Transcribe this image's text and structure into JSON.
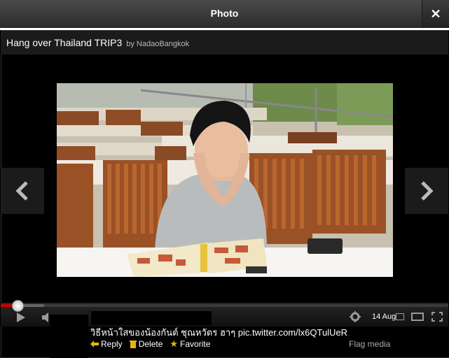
{
  "window": {
    "title": "Photo"
  },
  "media": {
    "title": "Hang over Thailand TRIP3",
    "byline": "by NadaoBangkok"
  },
  "player": {
    "date": "14 Aug"
  },
  "tweet": {
    "text": "วิธีหน้าใสของน้องกันต์ ชุณหวัตร ฮาๆ pic.twitter.com/lx6QTulUeR",
    "actions": {
      "reply": "Reply",
      "delete": "Delete",
      "favorite": "Favorite"
    },
    "flag": "Flag media"
  },
  "colors": {
    "progress_played": "#cc0000",
    "favorite_star": "#e8b800",
    "reply_arrow": "#e8b800"
  }
}
